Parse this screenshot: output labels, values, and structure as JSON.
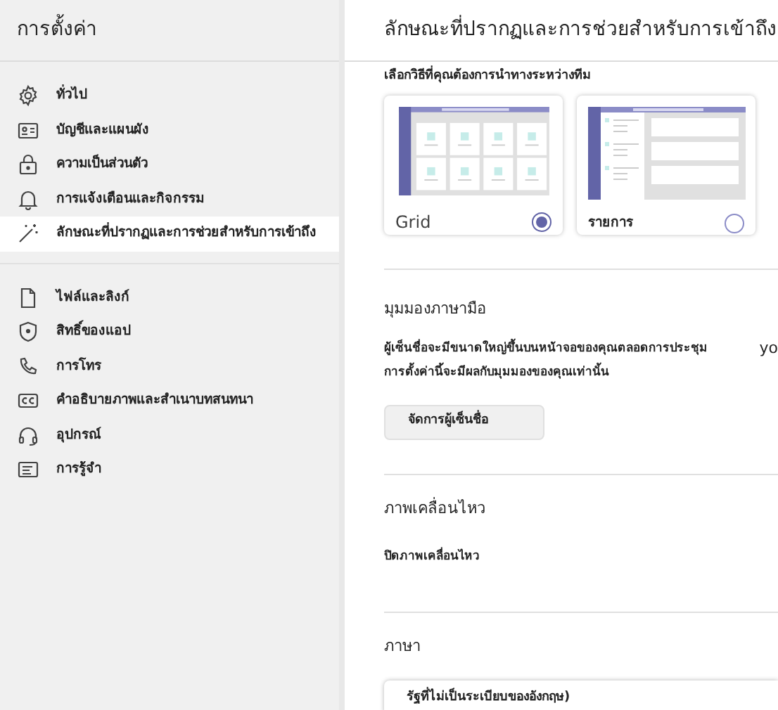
{
  "sidebar": {
    "title": "การตั้งค่า",
    "groups": [
      [
        {
          "label": "ทั่วไป",
          "kind": "gear",
          "selected": false
        },
        {
          "label": "บัญชีและแผนผัง",
          "kind": "card",
          "selected": false
        },
        {
          "label": "ความเป็นส่วนตัว",
          "kind": "lock",
          "selected": false
        },
        {
          "label": "การแจ้งเตือนและกิจกรรม",
          "kind": "bell",
          "selected": false
        },
        {
          "label": "ลักษณะที่ปรากฏและการช่วยสำหรับการเข้าถึง",
          "kind": "wand",
          "selected": true
        }
      ],
      [
        {
          "label": "ไฟล์และลิงก์",
          "kind": "file",
          "selected": false
        },
        {
          "label": "สิทธิ์ของแอป",
          "kind": "shield",
          "selected": false
        },
        {
          "label": "การโทร",
          "kind": "phone",
          "selected": false
        },
        {
          "label": "คำอธิบายภาพและสำเนาบทสนทนา",
          "kind": "cc",
          "selected": false
        },
        {
          "label": "อุปกรณ์",
          "kind": "headset",
          "selected": false
        },
        {
          "label": "การรู้จำ",
          "kind": "note",
          "selected": false
        }
      ]
    ]
  },
  "content": {
    "title": "ลักษณะที่ปรากฏและการช่วยสำหรับการเข้าถึง",
    "layout": {
      "prompt": "เลือกวิธีที่คุณต้องการนำทางระหว่างทีม",
      "options": [
        {
          "label": "Grid",
          "kind": "grid",
          "selected": true
        },
        {
          "label": "รายการ",
          "kind": "list",
          "selected": false
        }
      ]
    },
    "sign_language": {
      "title": "มุมมองภาษามือ",
      "description": "ผู้เซ็นชื่อจะมีขนาดใหญ่ขึ้นบนหน้าจอของคุณตลอดการประชุม",
      "description_cut": "yo",
      "note": "การตั้งค่านี้จะมีผลกับมุมมองของคุณเท่านั้น",
      "button": "จัดการผู้เซ็นชื่อ"
    },
    "animation": {
      "title": "ภาพเคลื่อนไหว",
      "option": "ปิดภาพเคลื่อนไหว"
    },
    "language": {
      "title": "ภาษา",
      "value": "รัฐที่ไม่เป็นระเบียบของอังกฤษ)"
    }
  }
}
